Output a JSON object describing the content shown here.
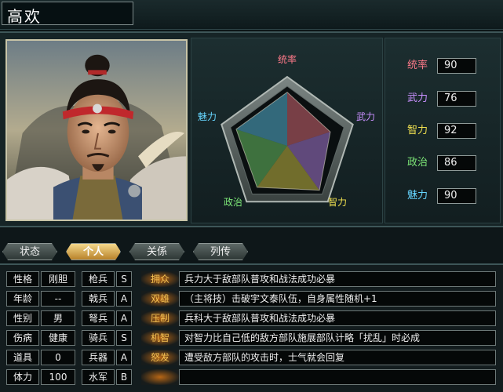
{
  "general": {
    "name": "高欢"
  },
  "radar": {
    "labels": {
      "top": "统率",
      "right": "武力",
      "bottom_right": "智力",
      "bottom_left": "政治",
      "left": "魅力"
    },
    "values": [
      90,
      76,
      92,
      86,
      90
    ],
    "max": 100
  },
  "stats": [
    {
      "label": "统率",
      "value": "90",
      "color": "#ff7a8a"
    },
    {
      "label": "武力",
      "value": "76",
      "color": "#c990ff"
    },
    {
      "label": "智力",
      "value": "92",
      "color": "#f0e050"
    },
    {
      "label": "政治",
      "value": "86",
      "color": "#7ee878"
    },
    {
      "label": "魅力",
      "value": "90",
      "color": "#66d6ff"
    }
  ],
  "tabs": [
    {
      "label": "状态",
      "active": false
    },
    {
      "label": "个人",
      "active": true
    },
    {
      "label": "关係",
      "active": false
    },
    {
      "label": "列传",
      "active": false
    }
  ],
  "info": [
    {
      "label": "性格",
      "value": "刚胆"
    },
    {
      "label": "年龄",
      "value": "--"
    },
    {
      "label": "性别",
      "value": "男"
    },
    {
      "label": "伤病",
      "value": "健康"
    },
    {
      "label": "道具",
      "value": "0"
    },
    {
      "label": "体力",
      "value": "100"
    }
  ],
  "aptitudes": [
    {
      "label": "枪兵",
      "grade": "S"
    },
    {
      "label": "戟兵",
      "grade": "A"
    },
    {
      "label": "弩兵",
      "grade": "A"
    },
    {
      "label": "骑兵",
      "grade": "S"
    },
    {
      "label": "兵器",
      "grade": "A"
    },
    {
      "label": "水军",
      "grade": "B"
    }
  ],
  "skills": [
    {
      "name": "拥众",
      "desc": "兵力大于敌部队普攻和战法成功必暴"
    },
    {
      "name": "双雄",
      "desc": "（主将技）击破宇文泰队伍，自身属性随机+1"
    },
    {
      "name": "压制",
      "desc": "兵科大于敌部队普攻和战法成功必暴"
    },
    {
      "name": "机智",
      "desc": "对智力比自己低的敌方部队施展部队计略「扰乱」时必成"
    },
    {
      "name": "怒发",
      "desc": "遭受敌方部队的攻击时，士气就会回复"
    },
    {
      "name": "",
      "desc": ""
    }
  ]
}
